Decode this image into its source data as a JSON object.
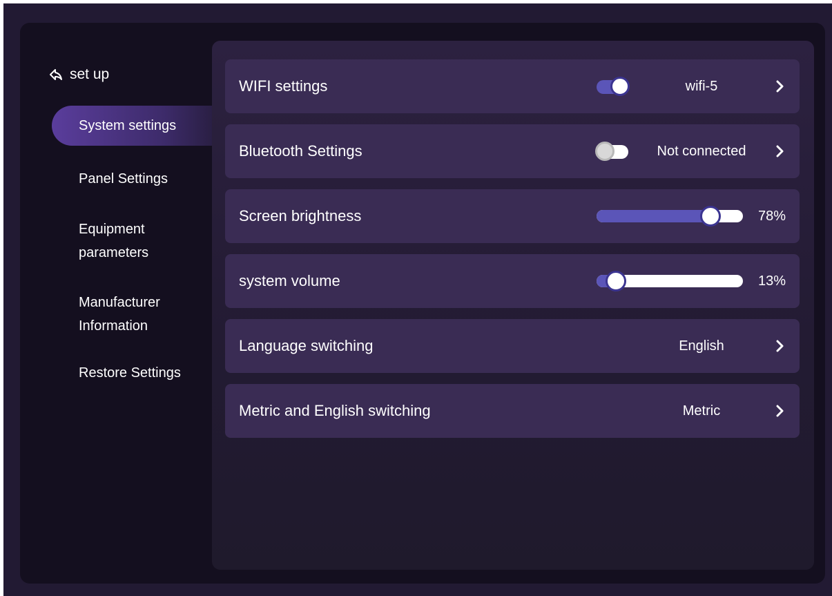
{
  "header": {
    "back_label": "set up"
  },
  "sidebar": {
    "items": [
      {
        "label": "System settings",
        "active": true
      },
      {
        "label": "Panel Settings",
        "active": false
      },
      {
        "label": "Equipment parameters",
        "active": false
      },
      {
        "label": "Manufacturer Information",
        "active": false
      },
      {
        "label": "Restore Settings",
        "active": false
      }
    ]
  },
  "settings": {
    "wifi": {
      "label": "WIFI settings",
      "enabled": true,
      "value": "wifi-5"
    },
    "bluetooth": {
      "label": "Bluetooth Settings",
      "enabled": false,
      "value": "Not connected"
    },
    "brightness": {
      "label": "Screen brightness",
      "percent": 78,
      "percent_text": "78%"
    },
    "volume": {
      "label": "system volume",
      "percent": 13,
      "percent_text": "13%"
    },
    "language": {
      "label": "Language switching",
      "value": "English"
    },
    "units": {
      "label": "Metric and English switching",
      "value": "Metric"
    }
  },
  "icons": {
    "back": "back-arrow-icon",
    "chevron": "chevron-right-icon"
  },
  "colors": {
    "accent": "#5b55b8",
    "row_bg": "#3a2c54",
    "background": "#140f1f"
  }
}
